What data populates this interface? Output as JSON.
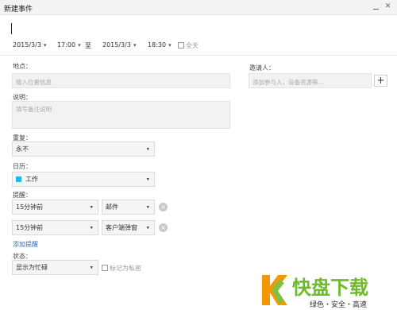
{
  "window": {
    "title": "新建事件"
  },
  "event": {
    "start_date": "2015/3/3",
    "start_time": "17:00",
    "to_label": "至",
    "end_date": "2015/3/3",
    "end_time": "18:30",
    "all_day_label": "全天"
  },
  "location": {
    "label": "地点：",
    "placeholder": "输入位置信息"
  },
  "description": {
    "label": "说明：",
    "placeholder": "填写备注说明"
  },
  "invitees": {
    "label": "邀请人：",
    "placeholder": "添加参与人，设备资源等...",
    "add_icon": "+"
  },
  "repeat": {
    "label": "重复：",
    "value": "永不"
  },
  "calendar": {
    "label": "日历：",
    "value": "工作",
    "color": "#2ab3e6"
  },
  "reminder": {
    "label": "提醒：",
    "items": [
      {
        "time": "15分钟前",
        "method": "邮件"
      },
      {
        "time": "15分钟前",
        "method": "客户端弹窗"
      }
    ],
    "add_label": "添加提醒"
  },
  "status": {
    "label": "状态：",
    "value": "显示为忙碌",
    "private_label": "标记为私密"
  },
  "watermark": {
    "name": "快盘下载",
    "tagline": "绿色・安全・高速"
  }
}
